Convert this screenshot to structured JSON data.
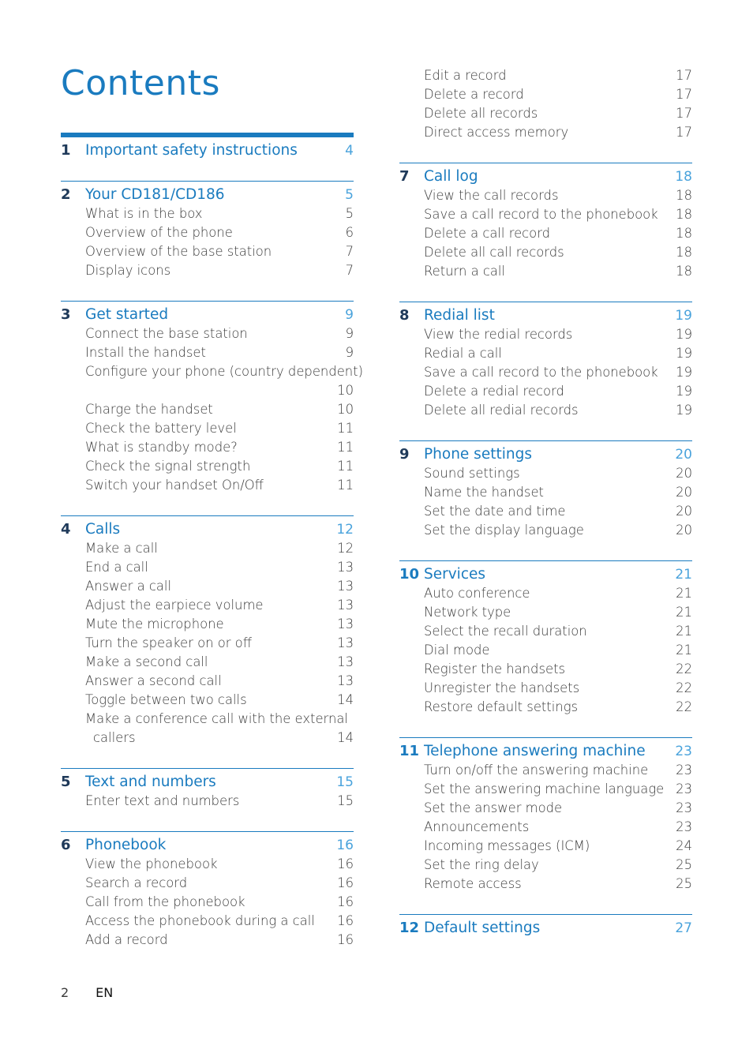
{
  "title": "Contents",
  "footer": {
    "page_number": "2",
    "language": "EN"
  },
  "left_sections": [
    {
      "number": "1",
      "title": "Important safety instructions",
      "page": "4",
      "items": []
    },
    {
      "number": "2",
      "title": "Your CD181/CD186",
      "page": "5",
      "items": [
        {
          "text": "What is in the box",
          "page": "5"
        },
        {
          "text": "Overview of the phone",
          "page": "6"
        },
        {
          "text": "Overview of the base station",
          "page": "7"
        },
        {
          "text": "Display icons",
          "page": "7"
        }
      ]
    },
    {
      "number": "3",
      "title": "Get started",
      "page": "9",
      "items": [
        {
          "text": "Connect the base station",
          "page": "9"
        },
        {
          "text": "Install the handset",
          "page": "9"
        },
        {
          "text": "Configure your phone (country dependent)",
          "page": "10",
          "wrap": true
        },
        {
          "text": "Charge the handset",
          "page": "10"
        },
        {
          "text": "Check the battery level",
          "page": "11"
        },
        {
          "text": "What is standby mode?",
          "page": "11"
        },
        {
          "text": "Check the signal strength",
          "page": "11"
        },
        {
          "text": "Switch your handset On/Off",
          "page": "11"
        }
      ]
    },
    {
      "number": "4",
      "title": "Calls",
      "page": "12",
      "items": [
        {
          "text": "Make a call",
          "page": "12"
        },
        {
          "text": "End a call",
          "page": "13"
        },
        {
          "text": "Answer a call",
          "page": "13"
        },
        {
          "text": "Adjust the earpiece volume",
          "page": "13"
        },
        {
          "text": "Mute the microphone",
          "page": "13"
        },
        {
          "text": "Turn the speaker on or off",
          "page": "13"
        },
        {
          "text": "Make a second call",
          "page": "13"
        },
        {
          "text": "Answer a second call",
          "page": "13"
        },
        {
          "text": "Toggle between two calls",
          "page": "14"
        },
        {
          "text": "Make a conference call with the external",
          "continuation": "callers",
          "page": "14"
        }
      ]
    },
    {
      "number": "5",
      "title": "Text and numbers",
      "page": "15",
      "items": [
        {
          "text": "Enter text and numbers",
          "page": "15"
        }
      ]
    },
    {
      "number": "6",
      "title": "Phonebook",
      "page": "16",
      "items": [
        {
          "text": "View the phonebook",
          "page": "16"
        },
        {
          "text": "Search a record",
          "page": "16"
        },
        {
          "text": "Call from the phonebook",
          "page": "16"
        },
        {
          "text": "Access the phonebook during a call",
          "page": "16"
        },
        {
          "text": "Add a record",
          "page": "16"
        }
      ]
    }
  ],
  "right_continued_items": [
    {
      "text": "Edit a record",
      "page": "17"
    },
    {
      "text": "Delete a record",
      "page": "17"
    },
    {
      "text": "Delete all records",
      "page": "17"
    },
    {
      "text": "Direct access memory",
      "page": "17"
    }
  ],
  "right_sections": [
    {
      "number": "7",
      "title": "Call log",
      "page": "18",
      "items": [
        {
          "text": "View the call records",
          "page": "18"
        },
        {
          "text": "Save a call record to the phonebook",
          "page": "18"
        },
        {
          "text": "Delete a call record",
          "page": "18"
        },
        {
          "text": "Delete all call records",
          "page": "18"
        },
        {
          "text": "Return a call",
          "page": "18"
        }
      ]
    },
    {
      "number": "8",
      "title": "Redial list",
      "page": "19",
      "items": [
        {
          "text": "View the redial records",
          "page": "19"
        },
        {
          "text": "Redial a call",
          "page": "19"
        },
        {
          "text": "Save a call record to the phonebook",
          "page": "19"
        },
        {
          "text": "Delete a redial record",
          "page": "19"
        },
        {
          "text": "Delete all redial records",
          "page": "19"
        }
      ]
    },
    {
      "number": "9",
      "title": "Phone settings",
      "page": "20",
      "items": [
        {
          "text": "Sound settings",
          "page": "20"
        },
        {
          "text": "Name the handset",
          "page": "20"
        },
        {
          "text": "Set the date and time",
          "page": "20"
        },
        {
          "text": "Set the display language",
          "page": "20"
        }
      ]
    },
    {
      "number": "10",
      "title": "Services",
      "page": "21",
      "items": [
        {
          "text": "Auto conference",
          "page": "21"
        },
        {
          "text": "Network type",
          "page": "21"
        },
        {
          "text": "Select the recall duration",
          "page": "21"
        },
        {
          "text": "Dial mode",
          "page": "21"
        },
        {
          "text": "Register the handsets",
          "page": "22"
        },
        {
          "text": "Unregister the handsets",
          "page": "22"
        },
        {
          "text": "Restore default settings",
          "page": "22"
        }
      ]
    },
    {
      "number": "11",
      "title": "Telephone answering machine",
      "page": "23",
      "items": [
        {
          "text": "Turn on/off the answering machine",
          "page": "23"
        },
        {
          "text": "Set the answering machine language",
          "page": "23"
        },
        {
          "text": "Set the answer mode",
          "page": "23"
        },
        {
          "text": "Announcements",
          "page": "23"
        },
        {
          "text": "Incoming messages (ICM)",
          "page": "24"
        },
        {
          "text": "Set the ring delay",
          "page": "25"
        },
        {
          "text": "Remote access",
          "page": "25"
        }
      ]
    },
    {
      "number": "12",
      "title": "Default settings",
      "page": "27",
      "items": []
    }
  ]
}
